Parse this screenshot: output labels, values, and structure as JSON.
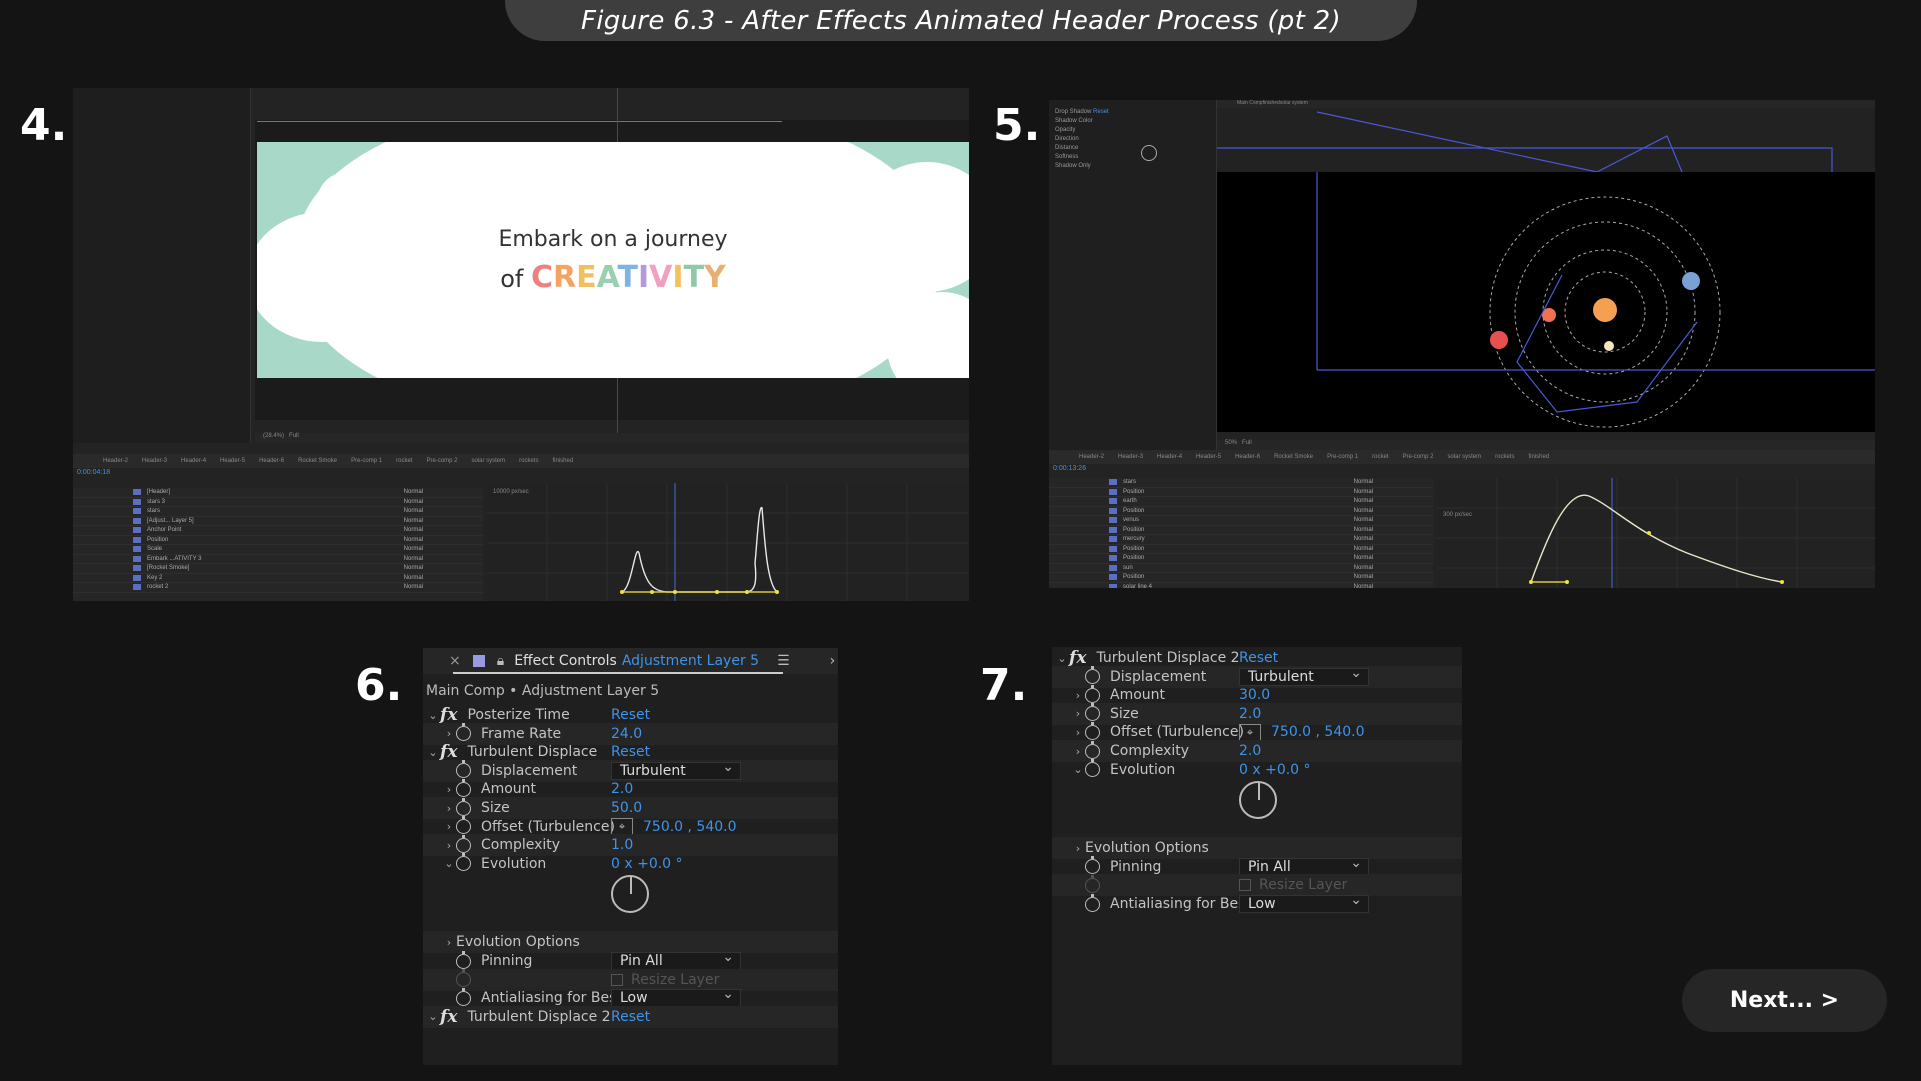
{
  "title": "Figure 6.3 - After Effects Animated Header Process (pt 2)",
  "steps": [
    "4.",
    "5.",
    "6.",
    "7."
  ],
  "next_label": "Next... >",
  "header_card": {
    "line1": "Embark on a journey",
    "line2_prefix": "of",
    "line2_word": "CREATIVITY",
    "bg": "#a8d8c8"
  },
  "creativity_colors": [
    "#f08080",
    "#f4a460",
    "#f0c060",
    "#9ad0b0",
    "#7fb3e0",
    "#b59ad8",
    "#f0a0c0",
    "#f4c060",
    "#90c8a8",
    "#e8b070"
  ],
  "panel4": {
    "zoom": "(28.4%)",
    "res": "Full",
    "time": "0:00:04:18",
    "tabs": [
      "Header-2",
      "Header-3",
      "Header-4",
      "Header-5",
      "Header-6",
      "Rocket Smoke",
      "Pre-comp 1",
      "rocket",
      "Pre-comp 2",
      "solar system",
      "rockets",
      "finished"
    ],
    "layers": [
      "[Header]",
      "stars 3",
      "stars",
      "[Adjust... Layer 5]",
      "Anchor Point",
      "Position",
      "Scale",
      "Embark ...ATIVITY 3",
      "[Rocket Smoke]",
      "Key 2",
      "rocket 2"
    ],
    "graph_label": "10000 px/sec"
  },
  "panel5": {
    "zoom": "50%",
    "res": "Full",
    "time": "0:00:13:26",
    "tabs": [
      "Header-2",
      "Header-3",
      "Header-4",
      "Header-5",
      "Header-6",
      "Rocket Smoke",
      "Pre-comp 1",
      "rocket",
      "Pre-comp 2",
      "solar system",
      "rockets",
      "finished"
    ],
    "breadcrumb": [
      "Main Comp",
      "finished",
      "solar system"
    ],
    "effect": "Drop Shadow",
    "effect_props": [
      "Shadow Color",
      "Opacity",
      "Direction",
      "Distance",
      "Softness",
      "Shadow Only"
    ],
    "layers": [
      "stars",
      "Position",
      "earth",
      "Position",
      "venus",
      "Position",
      "mercury",
      "Position",
      "Position",
      "sun",
      "Position",
      "solar line 4"
    ],
    "graph_label": "300 px/sec"
  },
  "panel6": {
    "tab_title": "Effect Controls",
    "tab_layer": "Adjustment Layer 5",
    "breadcrumb": "Main Comp • Adjustment Layer 5",
    "rows": [
      {
        "type": "fx",
        "label": "Posterize Time",
        "value": "Reset"
      },
      {
        "type": "prop",
        "label": "Frame Rate",
        "value": "24.0"
      },
      {
        "type": "fx",
        "label": "Turbulent Displace",
        "value": "Reset"
      },
      {
        "type": "dd",
        "label": "Displacement",
        "value": "Turbulent"
      },
      {
        "type": "prop",
        "label": "Amount",
        "value": "2.0"
      },
      {
        "type": "prop",
        "label": "Size",
        "value": "50.0"
      },
      {
        "type": "offset",
        "label": "Offset (Turbulence)",
        "value": "750.0 , 540.0"
      },
      {
        "type": "prop",
        "label": "Complexity",
        "value": "1.0"
      },
      {
        "type": "prop",
        "label": "Evolution",
        "value": "0 x +0.0 °"
      },
      {
        "type": "group",
        "label": "Evolution Options"
      },
      {
        "type": "dd",
        "label": "Pinning",
        "value": "Pin All"
      },
      {
        "type": "check",
        "label": "Resize Layer"
      },
      {
        "type": "dd",
        "label": "Antialiasing for Best Qu",
        "value": "Low"
      },
      {
        "type": "fx",
        "label": "Turbulent Displace 2",
        "value": "Reset"
      }
    ]
  },
  "panel7": {
    "rows": [
      {
        "type": "fx",
        "label": "Turbulent Displace 2",
        "value": "Reset"
      },
      {
        "type": "dd",
        "label": "Displacement",
        "value": "Turbulent"
      },
      {
        "type": "prop",
        "label": "Amount",
        "value": "30.0"
      },
      {
        "type": "prop",
        "label": "Size",
        "value": "2.0"
      },
      {
        "type": "offset",
        "label": "Offset (Turbulence)",
        "value": "750.0 , 540.0"
      },
      {
        "type": "prop",
        "label": "Complexity",
        "value": "2.0"
      },
      {
        "type": "prop",
        "label": "Evolution",
        "value": "0 x +0.0 °"
      },
      {
        "type": "group",
        "label": "Evolution Options"
      },
      {
        "type": "dd",
        "label": "Pinning",
        "value": "Pin All"
      },
      {
        "type": "check",
        "label": "Resize Layer"
      },
      {
        "type": "dd",
        "label": "Antialiasing for Best Qu",
        "value": "Low"
      }
    ]
  }
}
